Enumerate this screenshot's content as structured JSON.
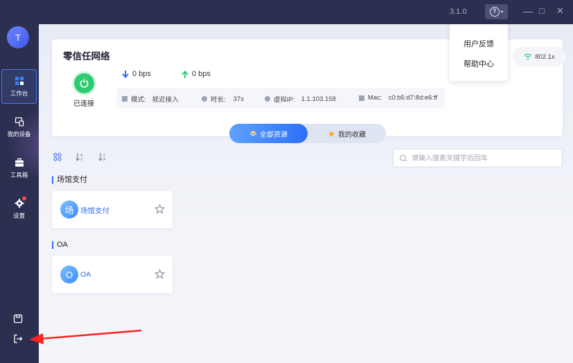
{
  "titlebar": {
    "version": "3.1.0",
    "minimize": "—",
    "maximize": "□",
    "close": "✕"
  },
  "help_menu": {
    "items": [
      "用户反馈",
      "帮助中心"
    ]
  },
  "sidebar": {
    "avatar_letter": "T",
    "items": [
      {
        "label": "工作台",
        "icon": "workbench-icon"
      },
      {
        "label": "我的设备",
        "icon": "devices-icon"
      },
      {
        "label": "工具箱",
        "icon": "toolbox-icon"
      },
      {
        "label": "设置",
        "icon": "settings-icon"
      }
    ]
  },
  "network": {
    "title": "零信任网络",
    "status": "已连接",
    "download": "0 bps",
    "upload": "0 bps",
    "mode_label": "模式:",
    "mode_value": "就近接入",
    "duration_label": "时长:",
    "duration_value": "37s",
    "vip_label": "虚拟IP:",
    "vip_value": "1.1.103.158",
    "mac_label": "Mac:",
    "mac_value": "c0:b5:d7:8d:e6:ff",
    "wifi": "802.1x"
  },
  "tabs": {
    "all": "全部资源",
    "favorites": "我的收藏"
  },
  "search": {
    "placeholder": "请输入搜索关键字后回车",
    "value": ""
  },
  "groups": [
    {
      "title": "场馆支付",
      "resource": {
        "icon_char": "场",
        "name": "场馆支付"
      }
    },
    {
      "title": "OA",
      "resource": {
        "icon_char": "O",
        "name": "OA"
      }
    }
  ],
  "colors": {
    "sidebar": "#2b2f50",
    "accent": "#2d6df7",
    "connected": "#2ecc71",
    "annotation": "#ff2020"
  }
}
